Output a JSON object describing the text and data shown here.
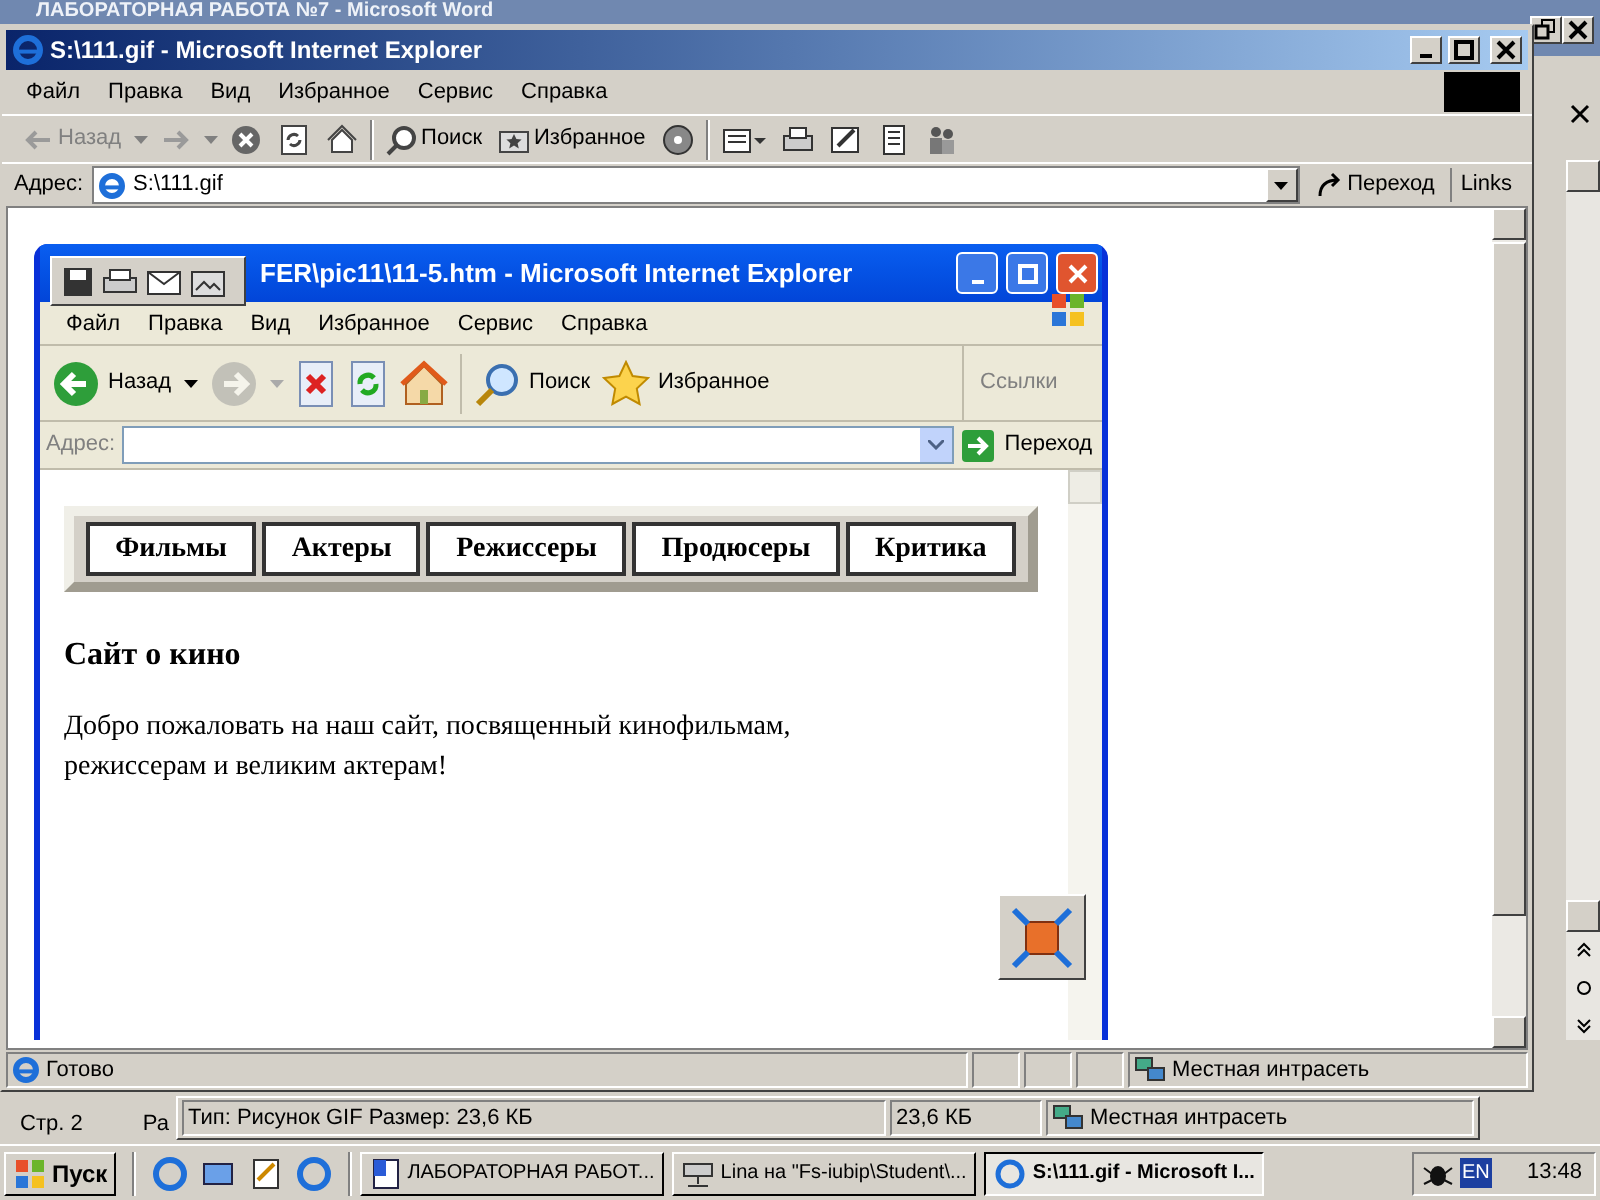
{
  "background_window": {
    "title": "ЛАБОРАТОРНАЯ РАБОТА №7 - Microsoft Word",
    "status_page": "Стр. 2",
    "status_column": "Ра"
  },
  "browser": {
    "title": "S:\\111.gif - Microsoft Internet Explorer",
    "menu": [
      "Файл",
      "Правка",
      "Вид",
      "Избранное",
      "Сервис",
      "Справка"
    ],
    "toolbar": [
      {
        "kind": "back",
        "label": "Назад",
        "disabled": true
      },
      {
        "kind": "forward",
        "disabled": true
      },
      {
        "kind": "stop"
      },
      {
        "kind": "refresh"
      },
      {
        "kind": "home"
      },
      {
        "kind": "search",
        "label": "Поиск"
      },
      {
        "kind": "favorites",
        "label": "Избранное"
      },
      {
        "kind": "media"
      },
      {
        "kind": "mail"
      },
      {
        "kind": "print"
      },
      {
        "kind": "edit"
      },
      {
        "kind": "discuss"
      },
      {
        "kind": "messenger"
      }
    ],
    "address_label": "Адрес:",
    "address": "S:\\111.gif",
    "go": "Переход",
    "links": "Links",
    "status": "Готово",
    "zone": "Местная интрасеть"
  },
  "image": {
    "title": "FER\\pic11\\11-5.htm - Microsoft Internet Explorer",
    "menu": [
      "Файл",
      "Правка",
      "Вид",
      "Избранное",
      "Сервис",
      "Справка"
    ],
    "toolbar": [
      {
        "kind": "back",
        "label": "Назад",
        "disabled": false
      },
      {
        "kind": "forward",
        "disabled": true
      },
      {
        "kind": "stop",
        "disabled": false
      },
      {
        "kind": "refresh",
        "disabled": false
      },
      {
        "kind": "home",
        "disabled": false
      },
      {
        "kind": "search",
        "label": "Поиск",
        "disabled": false
      },
      {
        "kind": "favorites",
        "label": "Избранное",
        "disabled": false
      }
    ],
    "links": "Ссылки",
    "address_label": "Адрес:",
    "go": "Переход",
    "nav": [
      "Фильмы",
      "Актеры",
      "Режиссеры",
      "Продюсеры",
      "Критика"
    ],
    "heading": "Сайт о кино",
    "paragraph": "Добро пожаловать на наш сайт, посвященный кинофильмам, режиссерам и великим актерам!"
  },
  "explorer_status": {
    "info": "Тип: Рисунок GIF Размер: 23,6 КБ",
    "size": "23,6 КБ",
    "zone": "Местная интрасеть"
  },
  "taskbar": {
    "start": "Пуск",
    "tasks": [
      {
        "kind": "word",
        "label": "ЛАБОРАТОРНАЯ РАБОТ...",
        "selected": false
      },
      {
        "kind": "drive",
        "label": "Lina на \"Fs-iubip\\Student\\...",
        "selected": false
      },
      {
        "kind": "ie",
        "label": "S:\\111.gif - Microsoft I...",
        "selected": true
      }
    ],
    "lang": "EN",
    "clock": "13:48"
  }
}
